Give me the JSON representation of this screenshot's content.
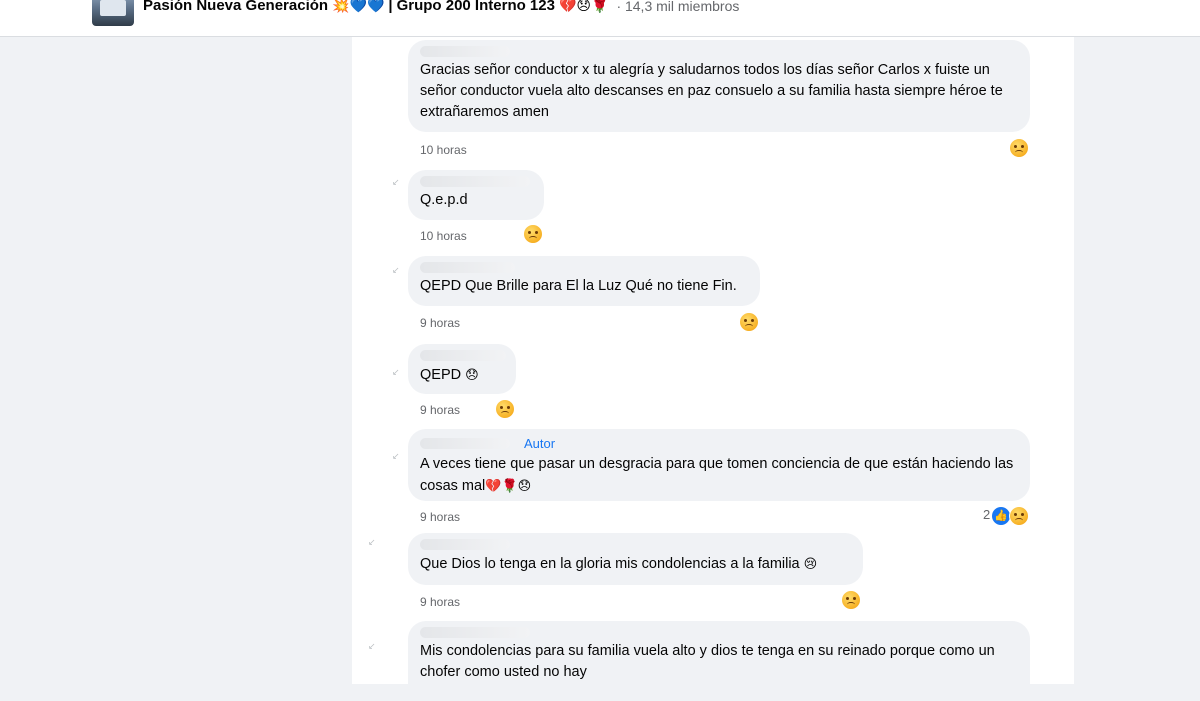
{
  "group": {
    "name": "Pasión Nueva Generación",
    "title_emojis_1": "💥💙💙",
    "separator": "|",
    "subtitle": "Grupo 200 Interno 123",
    "title_emojis_2": "💔😞🌹",
    "members": "· 14,3 mil miembros"
  },
  "comments": [
    {
      "text": "Gracias señor conductor x tu alegría y saludarnos todos los días señor Carlos x fuiste un señor conductor vuela alto descanses en paz consuelo a su familia hasta siempre héroe te extrañaremos amen",
      "time": "10 horas",
      "reaction": "sad-reaction"
    },
    {
      "text": "Q.e.p.d",
      "time": "10 horas",
      "reaction": "sad-reaction"
    },
    {
      "text": "QEPD Que Brille para El la Luz Qué no tiene Fin.",
      "time": "9 horas",
      "reaction": "sad-reaction"
    },
    {
      "text": "QEPD",
      "emoji": "😞",
      "time": "9 horas",
      "reaction": "sad-reaction"
    },
    {
      "author_tag": "Autor",
      "text": "A veces tiene que pasar un desgracia para que tomen conciencia de que están haciendo las cosas mal",
      "emoji": "💔🌹😞",
      "time": "9 horas",
      "reaction_count": "2",
      "reaction": "like-and-sad-reaction"
    },
    {
      "text": "Que Dios lo tenga en la gloria mis condolencias a la familia",
      "emoji": "😢",
      "time": "9 horas",
      "reaction": "sad-reaction"
    },
    {
      "text": "Mis condolencias para su familia vuela alto y dios te tenga en su reinado porque como un chofer como usted no hay"
    }
  ],
  "icons": {
    "like": "👍",
    "reply_arrow": "↙"
  }
}
